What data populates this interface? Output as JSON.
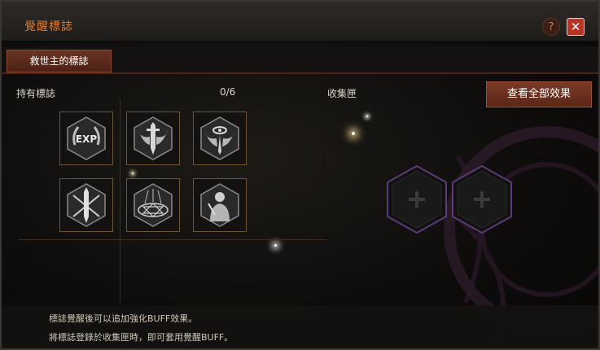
{
  "window": {
    "title": "覺醒標誌",
    "help_symbol": "?",
    "close_symbol": "✕"
  },
  "tabs": [
    {
      "label": "救世主的標誌",
      "active": true
    }
  ],
  "holding": {
    "label": "持有標誌",
    "count": "0/6"
  },
  "collection": {
    "label": "收集匣"
  },
  "view_all_button": {
    "label": "查看全部效果"
  },
  "emblems": [
    {
      "icon": "exp-laurel-icon",
      "text": "EXP"
    },
    {
      "icon": "winged-sword-icon"
    },
    {
      "icon": "winged-eye-icon"
    },
    {
      "icon": "crossed-arrows-sword-icon"
    },
    {
      "icon": "magic-circle-icon"
    },
    {
      "icon": "warrior-portrait-icon"
    }
  ],
  "collection_slots": [
    {
      "icon": "plus-icon"
    },
    {
      "icon": "plus-icon"
    }
  ],
  "info": {
    "line1": "標誌覺醒後可以追加強化BUFF效果。",
    "line2": "將標誌登錄於收集匣時，即可套用覺醒BUFF。"
  },
  "colors": {
    "accent": "#e07a2c",
    "button": "#6a3422",
    "slot_border": "#6e5634",
    "hex_border": "#5a3a78"
  }
}
